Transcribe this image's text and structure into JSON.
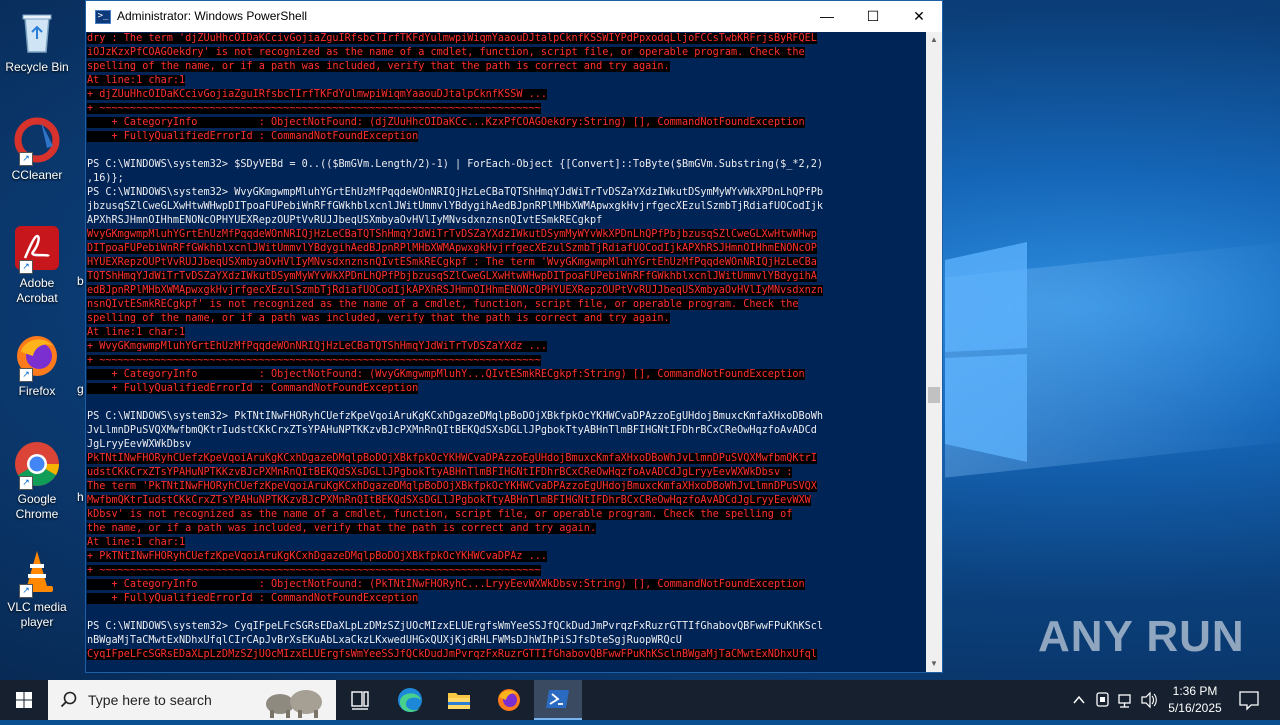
{
  "desktop": {
    "icons": [
      {
        "label": "Recycle Bin"
      },
      {
        "label": "CCleaner"
      },
      {
        "label": "Adobe\nAcrobat"
      },
      {
        "label": "Firefox"
      },
      {
        "label": "Google\nChrome"
      },
      {
        "label": "VLC media\nplayer"
      }
    ],
    "partial_labels": [
      "b",
      "g",
      "h"
    ]
  },
  "window": {
    "title": "Administrator: Windows PowerShell",
    "minimize": "—",
    "maximize": "☐",
    "close": "✕"
  },
  "console_lines": [
    {
      "t": "dry : The term 'djZUuHhcOIDaKCcivGojiaZguIRfsbcTIrfTKFdYulmwpiWiqmYaaouDJtalpCknfKSSWIYPdPpxodqLljoFCCsTwbKRFrjsByRFQEL",
      "c": "err"
    },
    {
      "t": "iOJzKzxPfCOAGOekdry' is not recognized as the name of a cmdlet, function, script file, or operable program. Check the",
      "c": "err"
    },
    {
      "t": "spelling of the name, or if a path was included, verify that the path is correct and try again.",
      "c": "err"
    },
    {
      "t": "At line:1 char:1",
      "c": "err"
    },
    {
      "t": "+ djZUuHhcOIDaKCcivGojiaZguIRfsbcTIrfTKFdYulmwpiWiqmYaaouDJtalpCknfKSSW ...",
      "c": "err"
    },
    {
      "t": "+ ~~~~~~~~~~~~~~~~~~~~~~~~~~~~~~~~~~~~~~~~~~~~~~~~~~~~~~~~~~~~~~~~~~~~~~~~",
      "c": "err"
    },
    {
      "t": "    + CategoryInfo          : ObjectNotFound: (djZUuHhcOIDaKCc...KzxPfCOAGOekdry:String) [], CommandNotFoundException",
      "c": "err"
    },
    {
      "t": "    + FullyQualifiedErrorId : CommandNotFoundException",
      "c": "err"
    },
    {
      "t": "",
      "c": ""
    },
    {
      "t": "PS C:\\WINDOWS\\system32> $SDyVEBd = 0..(($BmGVm.Length/2)-1) | ForEach-Object {[Convert]::ToByte($BmGVm.Substring($_*2,2)",
      "c": ""
    },
    {
      "t": ",16)};",
      "c": ""
    },
    {
      "t": "PS C:\\WINDOWS\\system32> WvyGKmgwmpMluhYGrtEhUzMfPqqdeWOnNRIQjHzLeCBaTQTShHmqYJdWiTrTvDSZaYXdzIWkutDSymMyWYvWkXPDnLhQPfPb",
      "c": ""
    },
    {
      "t": "jbzusqSZlCweGLXwHtwWHwpDITpoaFUPebiWnRFfGWkhblxcnlJWitUmmvlYBdygihAedBJpnRPlMHbXWMApwxgkHvjrfgecXEzulSzmbTjRdiafUOCodIjk",
      "c": ""
    },
    {
      "t": "APXhRSJHmnOIHhmENONcOPHYUEXRepzOUPtVvRUJJbeqUSXmbyaOvHVlIyMNvsdxnznsnQIvtESmkRECgkpf",
      "c": ""
    },
    {
      "t": "WvyGKmgwmpMluhYGrtEhUzMfPqqdeWOnNRIQjHzLeCBaTQTShHmqYJdWiTrTvDSZaYXdzIWkutDSymMyWYvWkXPDnLhQPfPbjbzusqSZlCweGLXwHtwWHwp",
      "c": "err"
    },
    {
      "t": "DITpoaFUPebiWnRFfGWkhblxcnlJWitUmmvlYBdygihAedBJpnRPlMHbXWMApwxgkHvjrfgecXEzulSzmbTjRdiafUOCodIjkAPXhRSJHmnOIHhmENONcOP",
      "c": "err"
    },
    {
      "t": "HYUEXRepzOUPtVvRUJJbeqUSXmbyaOvHVlIyMNvsdxnznsnQIvtESmkRECgkpf : The term 'WvyGKmgwmpMluhYGrtEhUzMfPqqdeWOnNRIQjHzLeCBa",
      "c": "err"
    },
    {
      "t": "TQTShHmqYJdWiTrTvDSZaYXdzIWkutDSymMyWYvWkXPDnLhQPfPbjbzusqSZlCweGLXwHtwWHwpDITpoaFUPebiWnRFfGWkhblxcnlJWitUmmvlYBdygihA",
      "c": "err"
    },
    {
      "t": "edBJpnRPlMHbXWMApwxgkHvjrfgecXEzulSzmbTjRdiafUOCodIjkAPXhRSJHmnOIHhmENONcOPHYUEXRepzOUPtVvRUJJbeqUSXmbyaOvHVlIyMNvsdxnzn",
      "c": "err"
    },
    {
      "t": "nsnQIvtESmkRECgkpf' is not recognized as the name of a cmdlet, function, script file, or operable program. Check the",
      "c": "err"
    },
    {
      "t": "spelling of the name, or if a path was included, verify that the path is correct and try again.",
      "c": "err"
    },
    {
      "t": "At line:1 char:1",
      "c": "err"
    },
    {
      "t": "+ WvyGKmgwmpMluhYGrtEhUzMfPqqdeWOnNRIQjHzLeCBaTQTShHmqYJdWiTrTvDSZaYXdz ...",
      "c": "err"
    },
    {
      "t": "+ ~~~~~~~~~~~~~~~~~~~~~~~~~~~~~~~~~~~~~~~~~~~~~~~~~~~~~~~~~~~~~~~~~~~~~~~~",
      "c": "err"
    },
    {
      "t": "    + CategoryInfo          : ObjectNotFound: (WvyGKmgwmpMluhY...QIvtESmkRECgkpf:String) [], CommandNotFoundException",
      "c": "err"
    },
    {
      "t": "    + FullyQualifiedErrorId : CommandNotFoundException",
      "c": "err"
    },
    {
      "t": "",
      "c": ""
    },
    {
      "t": "PS C:\\WINDOWS\\system32> PkTNtINwFHORyhCUefzKpeVqoiAruKgKCxhDgazeDMqlpBoDOjXBkfpkOcYKHWCvaDPAzzoEgUHdojBmuxcKmfaXHxoDBoWh",
      "c": ""
    },
    {
      "t": "JvLlmnDPuSVQXMwfbmQKtrIudstCKkCrxZTsYPAHuNPTKKzvBJcPXMnRnQItBEKQdSXsDGLlJPgbokTtyABHnTlmBFIHGNtIFDhrBCxCReOwHqzfoAvADCd",
      "c": ""
    },
    {
      "t": "JgLryyEevWXWkDbsv",
      "c": ""
    },
    {
      "t": "PkTNtINwFHORyhCUefzKpeVqoiAruKgKCxhDgazeDMqlpBoDOjXBkfpkOcYKHWCvaDPAzzoEgUHdojBmuxcKmfaXHxoDBoWhJvLlmnDPuSVQXMwfbmQKtrI",
      "c": "err"
    },
    {
      "t": "udstCKkCrxZTsYPAHuNPTKKzvBJcPXMnRnQItBEKQdSXsDGLlJPgbokTtyABHnTlmBFIHGNtIFDhrBCxCReOwHqzfoAvADCdJgLryyEevWXWkDbsv :",
      "c": "err"
    },
    {
      "t": "The term 'PkTNtINwFHORyhCUefzKpeVqoiAruKgKCxhDgazeDMqlpBoDOjXBkfpkOcYKHWCvaDPAzzoEgUHdojBmuxcKmfaXHxoDBoWhJvLlmnDPuSVQX",
      "c": "err"
    },
    {
      "t": "MwfbmQKtrIudstCKkCrxZTsYPAHuNPTKKzvBJcPXMnRnQItBEKQdSXsDGLlJPgbokTtyABHnTlmBFIHGNtIFDhrBCxCReOwHqzfoAvADCdJgLryyEevWXW",
      "c": "err"
    },
    {
      "t": "kDbsv' is not recognized as the name of a cmdlet, function, script file, or operable program. Check the spelling of",
      "c": "err"
    },
    {
      "t": "the name, or if a path was included, verify that the path is correct and try again.",
      "c": "err"
    },
    {
      "t": "At line:1 char:1",
      "c": "err"
    },
    {
      "t": "+ PkTNtINwFHORyhCUefzKpeVqoiAruKgKCxhDgazeDMqlpBoDOjXBkfpkOcYKHWCvaDPAz ...",
      "c": "err"
    },
    {
      "t": "+ ~~~~~~~~~~~~~~~~~~~~~~~~~~~~~~~~~~~~~~~~~~~~~~~~~~~~~~~~~~~~~~~~~~~~~~~~",
      "c": "err"
    },
    {
      "t": "    + CategoryInfo          : ObjectNotFound: (PkTNtINwFHORyhC...LryyEevWXWkDbsv:String) [], CommandNotFoundException",
      "c": "err"
    },
    {
      "t": "    + FullyQualifiedErrorId : CommandNotFoundException",
      "c": "err"
    },
    {
      "t": "",
      "c": ""
    },
    {
      "t": "PS C:\\WINDOWS\\system32> CyqIFpeLFcSGRsEDaXLpLzDMzSZjUOcMIzxELUErgfsWmYeeSSJfQCkDudJmPvrqzFxRuzrGTTIfGhabovQBFwwFPuKhKScl",
      "c": ""
    },
    {
      "t": "nBWgaMjTaCMwtExNDhxUfqlCIrCApJvBrXsEKuAbLxaCkzLKxwedUHGxQUXjKjdRHLFWMsDJhWIhPiSJfsDteSgjRuopWRQcU",
      "c": ""
    },
    {
      "t": "CyqIFpeLFcSGRsEDaXLpLzDMzSZjUOcMIzxELUErgfsWmYeeSSJfQCkDudJmPvrqzFxRuzrGTTIfGhabovQBFwwFPuKhKSclnBWgaMjTaCMwtExNDhxUfql",
      "c": "err"
    }
  ],
  "watermark": "ANY RUN",
  "taskbar": {
    "search_placeholder": "Type here to search",
    "time": "1:36 PM",
    "date": "5/16/2025"
  },
  "colors": {
    "console_bg": "#012456",
    "error_fg": "#ff3030",
    "taskbar_bg": "#16202e"
  }
}
